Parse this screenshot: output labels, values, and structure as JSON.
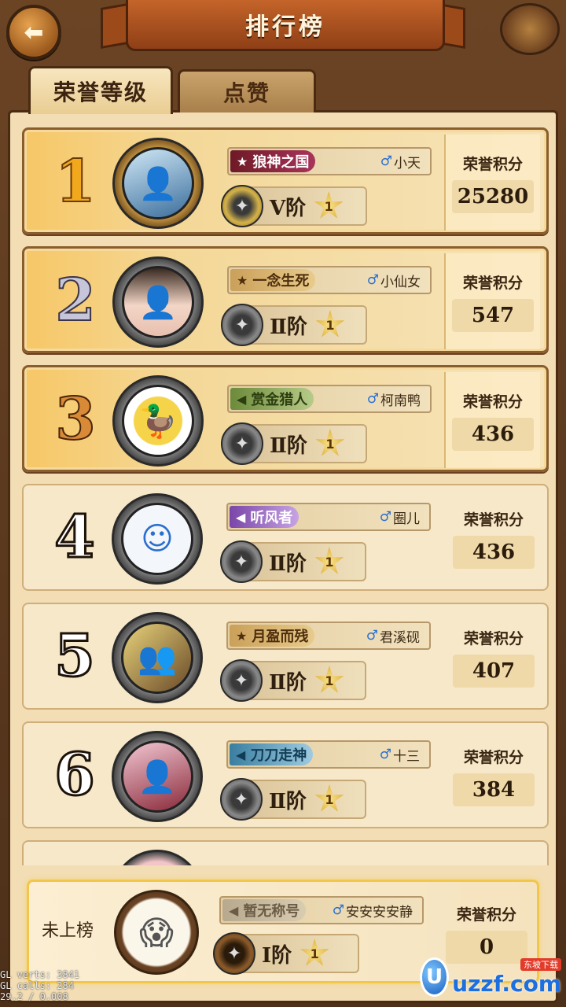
{
  "header": {
    "title": "排行榜",
    "back_icon": "back-arrow-icon"
  },
  "tabs": [
    {
      "label": "荣誉等级",
      "active": true
    },
    {
      "label": "点赞",
      "active": false
    }
  ],
  "score_label": "荣誉积分",
  "rows": [
    {
      "rank": "1",
      "title": "狼神之国",
      "title_color": "red",
      "player": "小天",
      "tier": "V阶",
      "star": "1",
      "score": "25280"
    },
    {
      "rank": "2",
      "title": "一念生死",
      "title_color": "gold",
      "player": "小仙女",
      "tier": "Ⅱ阶",
      "star": "1",
      "score": "547"
    },
    {
      "rank": "3",
      "title": "赏金猎人",
      "title_color": "green",
      "player": "柯南鸭",
      "tier": "Ⅱ阶",
      "star": "1",
      "score": "436"
    },
    {
      "rank": "4",
      "title": "听风者",
      "title_color": "purple",
      "player": "圈儿",
      "tier": "Ⅱ阶",
      "star": "1",
      "score": "436"
    },
    {
      "rank": "5",
      "title": "月盈而残",
      "title_color": "gold",
      "player": "君溪砚",
      "tier": "Ⅱ阶",
      "star": "1",
      "score": "407"
    },
    {
      "rank": "6",
      "title": "刀刀走神",
      "title_color": "blue",
      "player": "十三",
      "tier": "Ⅱ阶",
      "star": "1",
      "score": "384"
    }
  ],
  "me": {
    "label": "未上榜",
    "title": "暂无称号",
    "player": "安安安安静",
    "tier": "Ⅰ阶",
    "star": "1",
    "score": "0"
  },
  "gl_hud": {
    "line1": "GL verts:   3841",
    "line2": "GL calls:    284",
    "line3": "29.2 / 0.008"
  },
  "watermark": {
    "small": "东坡下载",
    "big": "uzzf.com"
  }
}
